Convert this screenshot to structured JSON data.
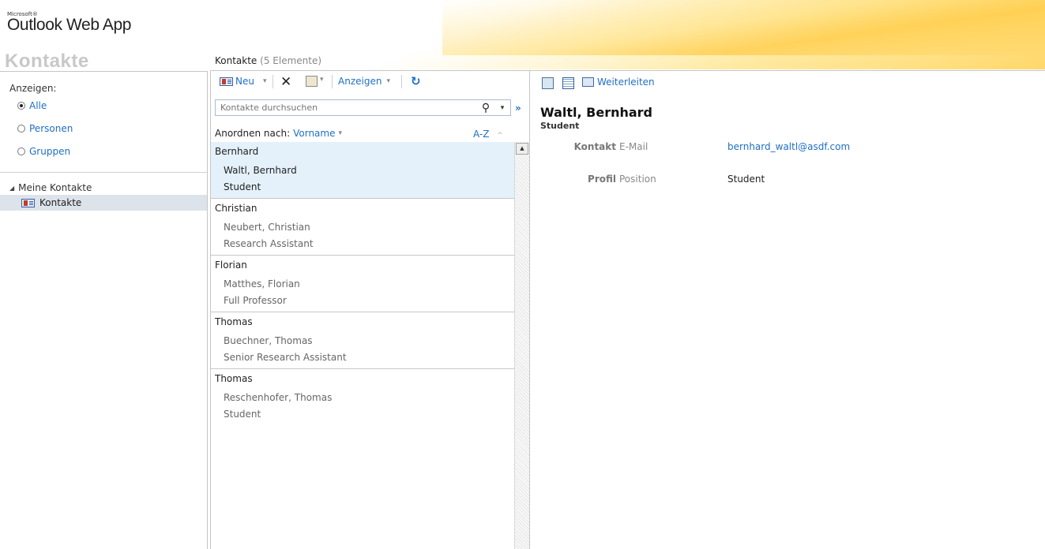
{
  "app": {
    "brand_small": "Microsoft®",
    "brand": "Outlook Web App",
    "module_title": "Kontakte"
  },
  "nav": {
    "show_label": "Anzeigen:",
    "filters": [
      {
        "label": "Alle",
        "selected": true
      },
      {
        "label": "Personen",
        "selected": false
      },
      {
        "label": "Gruppen",
        "selected": false
      }
    ],
    "tree_root": "Meine Kontakte",
    "tree_item": "Kontakte"
  },
  "list": {
    "title": "Kontakte",
    "count": "(5 Elemente)",
    "toolbar": {
      "new_label": "Neu",
      "view_label": "Anzeigen"
    },
    "search_placeholder": "Kontakte durchsuchen",
    "sort_label": "Anordnen nach:",
    "sort_value": "Vorname",
    "order_label": "A-Z",
    "groups": [
      {
        "header": "Bernhard",
        "name": "Waltl, Bernhard",
        "sub": "Student",
        "selected": true
      },
      {
        "header": "Christian",
        "name": "Neubert, Christian",
        "sub": "Research Assistant",
        "selected": false
      },
      {
        "header": "Florian",
        "name": "Matthes, Florian",
        "sub": "Full Professor",
        "selected": false
      },
      {
        "header": "Thomas",
        "name": "Buechner, Thomas",
        "sub": "Senior Research Assistant",
        "selected": false
      },
      {
        "header": "Thomas",
        "name": "Reschenhofer, Thomas",
        "sub": "Student",
        "selected": false
      }
    ]
  },
  "reading": {
    "forward_label": "Weiterleiten",
    "name": "Waltl, Bernhard",
    "subtitle": "Student",
    "sections": [
      {
        "section": "Kontakt",
        "label": "E-Mail",
        "value": "bernhard_waltl@asdf.com",
        "link": true
      },
      {
        "section": "Profil",
        "label": "Position",
        "value": "Student",
        "link": false
      }
    ]
  },
  "colors": {
    "link": "#1f6fc5",
    "selected_row": "#e4f1fb",
    "nav_selected": "#dde3ea"
  }
}
